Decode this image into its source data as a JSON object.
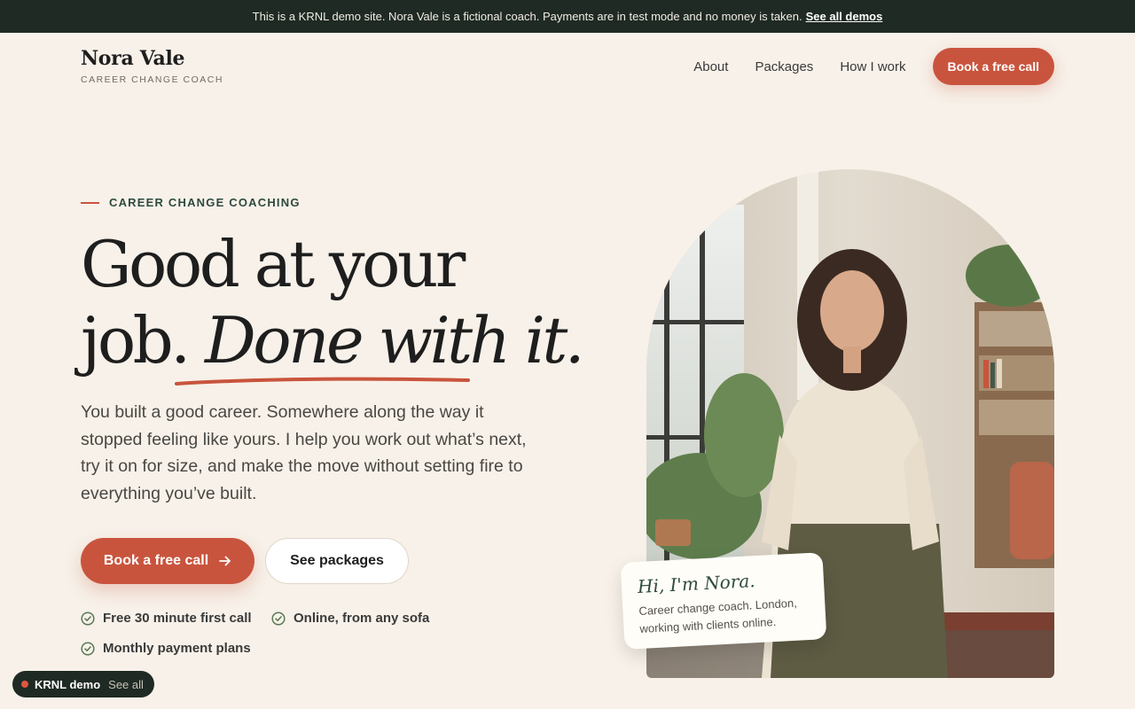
{
  "topbar": {
    "message": "This is a KRNL demo site. Nora Vale is a fictional coach. Payments are in test mode and no money is taken.",
    "link": "See all demos"
  },
  "brand": {
    "name": "Nora Vale",
    "tagline": "CAREER CHANGE COACH"
  },
  "nav": {
    "items": [
      "About",
      "Packages",
      "How I work"
    ],
    "cta": "Book a free call"
  },
  "hero": {
    "eyebrow": "CAREER CHANGE COACHING",
    "headline_line1": "Good at your",
    "headline_line2_plain": "job. ",
    "headline_line2_italic": "Done with it.",
    "lead": "You built a good career. Somewhere along the way it stopped feeling like yours. I help you work out what’s next, try it on for size, and make the move without setting fire to everything you’ve built.",
    "primary_cta": "Book a free call",
    "secondary_cta": "See packages",
    "checks": [
      "Free 30 minute first call",
      "Online, from any sofa",
      "Monthly payment plans"
    ]
  },
  "card": {
    "title": "Hi, I'm Nora.",
    "body": "Career change coach. London, working with clients online."
  },
  "demo_badge": {
    "label": "KRNL demo",
    "link": "See all"
  },
  "colors": {
    "accent": "#c9543d",
    "dark": "#1f2a24",
    "background": "#f7f1e9",
    "green": "#2d4a3e"
  }
}
